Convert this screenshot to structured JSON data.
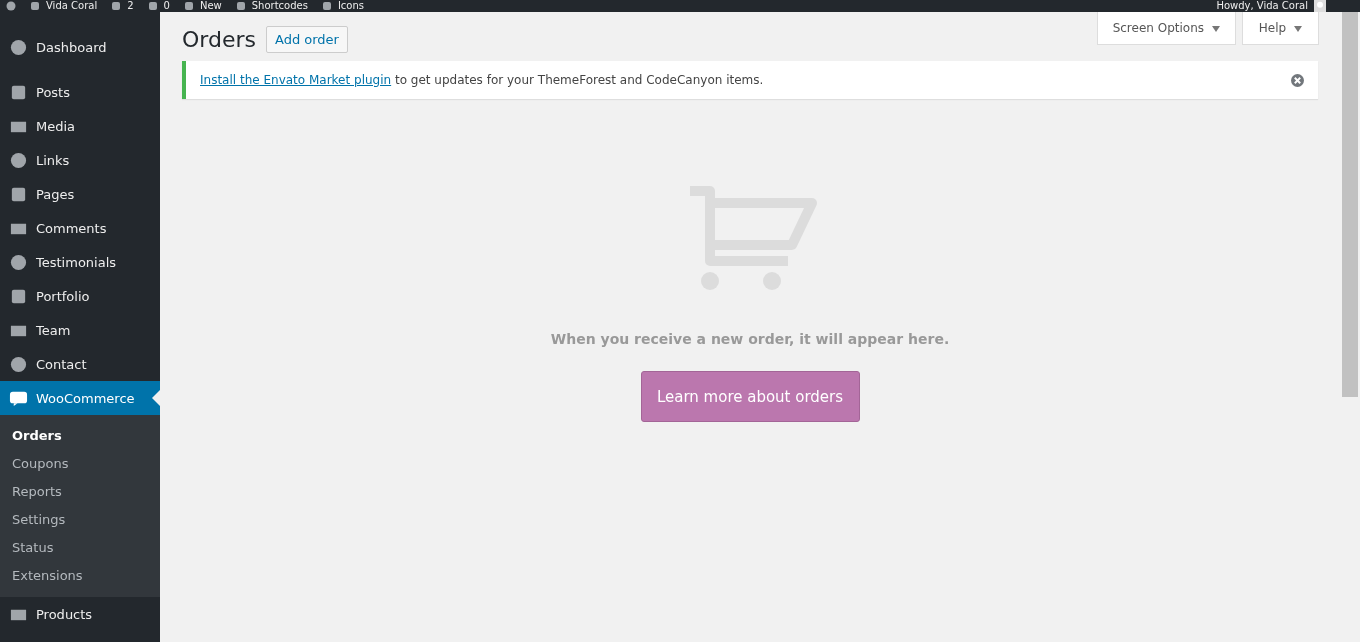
{
  "admin_bar": {
    "items": [
      {
        "label": "Vida Coral"
      },
      {
        "label": "2"
      },
      {
        "label": "0"
      },
      {
        "label": "New"
      },
      {
        "label": "Shortcodes"
      },
      {
        "label": "Icons"
      }
    ],
    "greeting": "Howdy, Vida Coral"
  },
  "sidebar": {
    "items": [
      {
        "label": "Dashboard",
        "selected": false
      },
      {
        "label": "Posts",
        "selected": false
      },
      {
        "label": "Media",
        "selected": false
      },
      {
        "label": "Links",
        "selected": false
      },
      {
        "label": "Pages",
        "selected": false
      },
      {
        "label": "Comments",
        "selected": false
      },
      {
        "label": "Testimonials",
        "selected": false
      },
      {
        "label": "Portfolio",
        "selected": false
      },
      {
        "label": "Team",
        "selected": false
      },
      {
        "label": "Contact",
        "selected": false
      },
      {
        "label": "WooCommerce",
        "selected": true,
        "children": [
          {
            "label": "Orders",
            "selected": true
          },
          {
            "label": "Coupons",
            "selected": false
          },
          {
            "label": "Reports",
            "selected": false
          },
          {
            "label": "Settings",
            "selected": false
          },
          {
            "label": "Status",
            "selected": false
          },
          {
            "label": "Extensions",
            "selected": false
          }
        ]
      },
      {
        "label": "Products",
        "selected": false
      }
    ]
  },
  "header": {
    "title": "Orders",
    "add_button": "Add order",
    "screen_options": "Screen Options",
    "help": "Help"
  },
  "notice": {
    "link": "Install the Envato Market plugin",
    "text": " to get updates for your ThemeForest and CodeCanyon items."
  },
  "empty_state": {
    "message": "When you receive a new order, it will appear here.",
    "button": "Learn more about orders"
  }
}
